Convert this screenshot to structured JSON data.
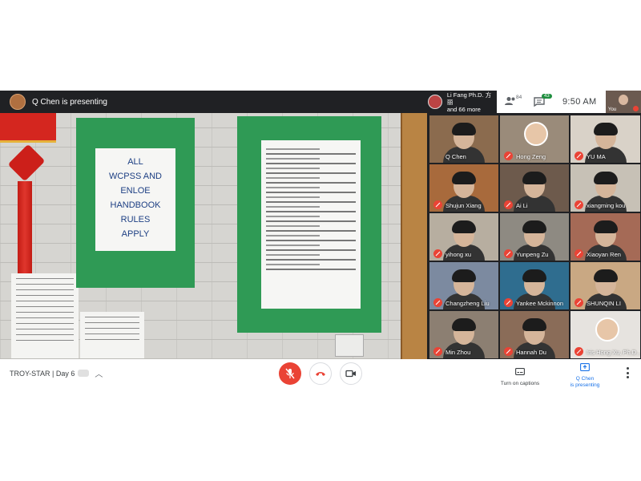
{
  "header": {
    "presenting_text": "Q Chen is presenting",
    "host_name": "Li Fang Ph.D. 方丽",
    "host_more": "and 66 more",
    "people_count": "84",
    "chat_badge": "43",
    "time": "9:50 AM",
    "self_label": "You"
  },
  "shared_screen": {
    "sign_lines": [
      "ALL",
      "WCPSS AND",
      "ENLOE",
      "HANDBOOK",
      "RULES",
      "APPLY"
    ]
  },
  "participants": [
    {
      "name": "Q Chen",
      "muted": false,
      "bg": "#8b6b4e"
    },
    {
      "name": "Hong Zeng",
      "muted": true,
      "bg": "#9a8b7a"
    },
    {
      "name": "YU MA",
      "muted": true,
      "bg": "#d9d2c8"
    },
    {
      "name": "Shujun Xiang",
      "muted": true,
      "bg": "#a86a3c"
    },
    {
      "name": "Ai Li",
      "muted": true,
      "bg": "#6d5a4c"
    },
    {
      "name": "xiangming kou",
      "muted": true,
      "bg": "#c7c1b6"
    },
    {
      "name": "yihong xu",
      "muted": true,
      "bg": "#b7aea0"
    },
    {
      "name": "Yunpeng Zu",
      "muted": true,
      "bg": "#8e8a82"
    },
    {
      "name": "Xiaoyan Ren",
      "muted": true,
      "bg": "#a56a56"
    },
    {
      "name": "Changzheng Liu",
      "muted": true,
      "bg": "#7c8aa0"
    },
    {
      "name": "Yankee Mckinnon",
      "muted": true,
      "bg": "#2f6d8f"
    },
    {
      "name": "SHUNQIN LI",
      "muted": true,
      "bg": "#c9a883"
    },
    {
      "name": "Min Zhou",
      "muted": true,
      "bg": "#8c7f72"
    },
    {
      "name": "Hannah Du",
      "muted": true,
      "bg": "#8a6c58"
    },
    {
      "name": "Iris Hong Xu, Ph.D...",
      "muted": true,
      "bg": "#e6e3df"
    }
  ],
  "footer": {
    "meeting_name": "TROY-STAR | Day 6",
    "captions_label": "Turn on captions",
    "presenting_label_1": "Q Chen",
    "presenting_label_2": "is presenting"
  },
  "colors": {
    "accent": "#1a73e8",
    "danger": "#ea4335",
    "dark_bg": "#202124"
  },
  "icons": [
    "people-icon",
    "chat-icon",
    "microphone-off-icon",
    "call-end-icon",
    "camera-icon",
    "captions-icon",
    "present-icon",
    "more-vert-icon"
  ]
}
